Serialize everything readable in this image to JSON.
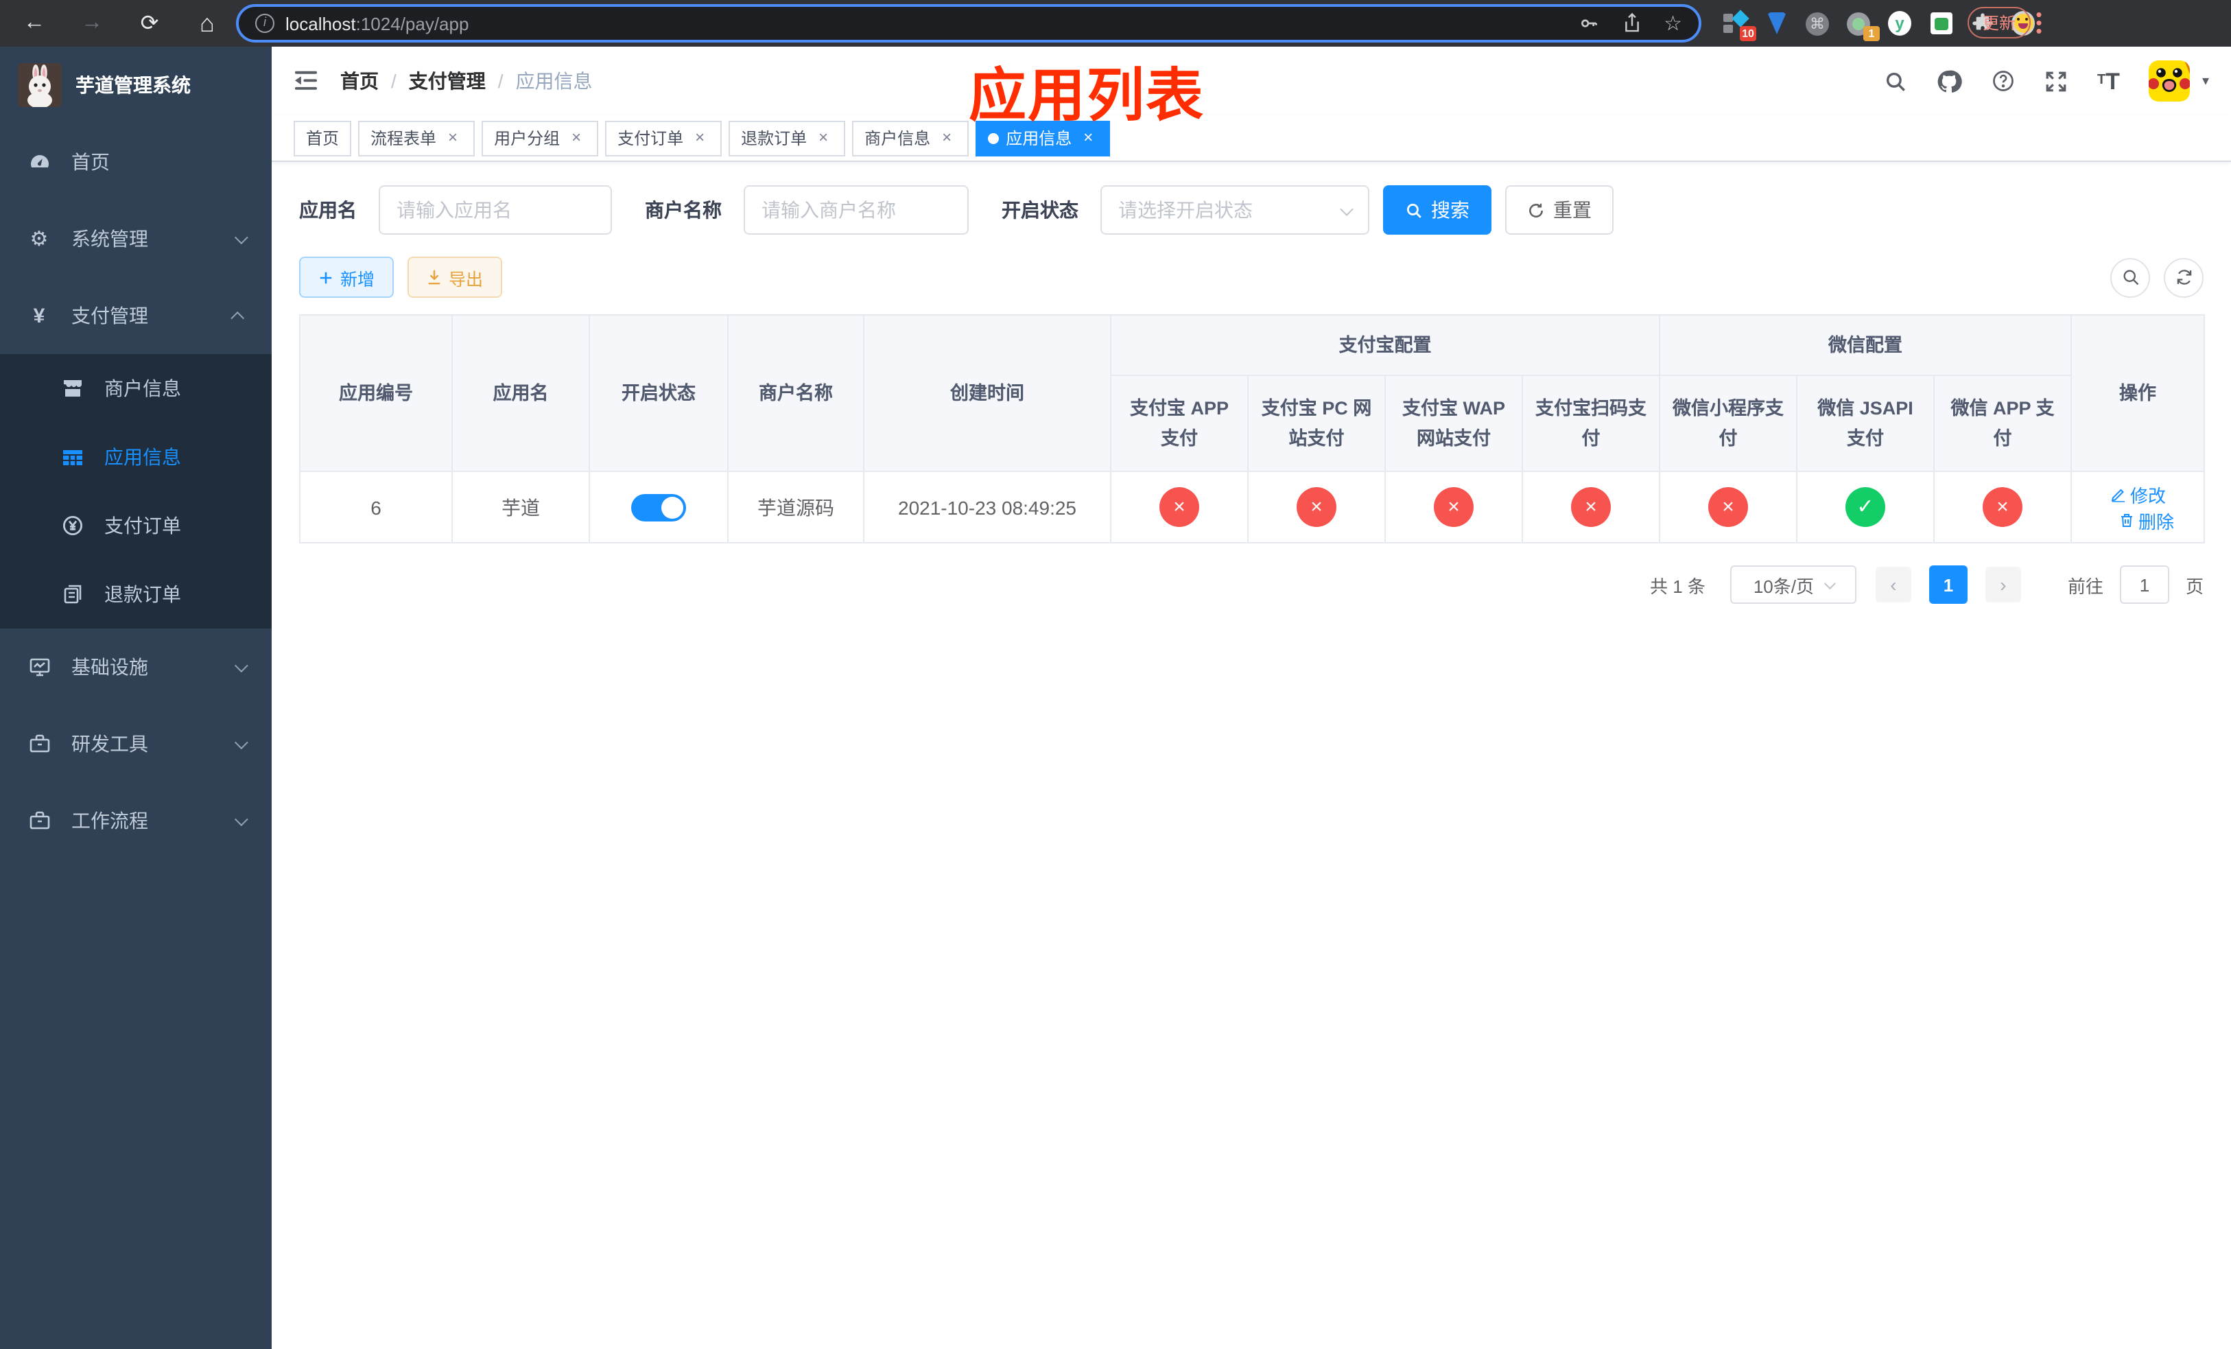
{
  "colors": {
    "primary": "#1890ff",
    "danger": "#f7534f",
    "success": "#13ce66",
    "annotation": "#ff2d00",
    "sidebar_bg": "#304156",
    "submenu_bg": "#1f2d3d"
  },
  "browser": {
    "url_host": "localhost",
    "url_rest": ":1024/pay/app",
    "update_button": "更新",
    "ext_badge_pink": "10",
    "ext_badge_orange": "1"
  },
  "sidebar": {
    "app_title": "芋道管理系统",
    "menu_home": "首页",
    "menu_system": "系统管理",
    "menu_pay": "支付管理",
    "menu_infra": "基础设施",
    "menu_dev": "研发工具",
    "menu_workflow": "工作流程",
    "sub_merchant": "商户信息",
    "sub_app": "应用信息",
    "sub_order": "支付订单",
    "sub_refund": "退款订单"
  },
  "header": {
    "breadcrumb": [
      {
        "label": "首页"
      },
      {
        "label": "支付管理"
      },
      {
        "label": "应用信息"
      }
    ],
    "annotation_title": "应用列表"
  },
  "tags": [
    {
      "label": "首页",
      "closable": false,
      "active": false
    },
    {
      "label": "流程表单",
      "closable": true,
      "active": false
    },
    {
      "label": "用户分组",
      "closable": true,
      "active": false
    },
    {
      "label": "支付订单",
      "closable": true,
      "active": false
    },
    {
      "label": "退款订单",
      "closable": true,
      "active": false
    },
    {
      "label": "商户信息",
      "closable": true,
      "active": false
    },
    {
      "label": "应用信息",
      "closable": true,
      "active": true
    }
  ],
  "filters": {
    "app_name_label": "应用名",
    "app_name_placeholder": "请输入应用名",
    "merchant_label": "商户名称",
    "merchant_placeholder": "请输入商户名称",
    "status_label": "开启状态",
    "status_placeholder": "请选择开启状态",
    "search_button": "搜索",
    "reset_button": "重置"
  },
  "toolbar": {
    "add_button": "新增",
    "export_button": "导出"
  },
  "table": {
    "columns": {
      "app_id": "应用编号",
      "app_name": "应用名",
      "status": "开启状态",
      "merchant": "商户名称",
      "created": "创建时间",
      "alipay_group": "支付宝配置",
      "wechat_group": "微信配置",
      "alipay_app": "支付宝 APP 支付",
      "alipay_pc": "支付宝 PC 网站支付",
      "alipay_wap": "支付宝 WAP 网站支付",
      "alipay_qr": "支付宝扫码支付",
      "wx_lite": "微信小程序支付",
      "wx_jsapi": "微信 JSAPI 支付",
      "wx_app": "微信 APP 支付",
      "actions": "操作"
    },
    "rows": [
      {
        "app_id": "6",
        "app_name": "芋道",
        "status_on": true,
        "merchant": "芋道源码",
        "created": "2021-10-23 08:49:25",
        "alipay_app": "disabled",
        "alipay_pc": "disabled",
        "alipay_wap": "disabled",
        "alipay_qr": "disabled",
        "wx_lite": "disabled",
        "wx_jsapi": "enabled",
        "wx_app": "disabled",
        "edit_label": "修改",
        "delete_label": "删除"
      }
    ]
  },
  "pagination": {
    "total": "共 1 条",
    "page_size": "10条/页",
    "current_page": "1",
    "goto_label": "前往",
    "goto_value": "1",
    "page_suffix": "页"
  }
}
